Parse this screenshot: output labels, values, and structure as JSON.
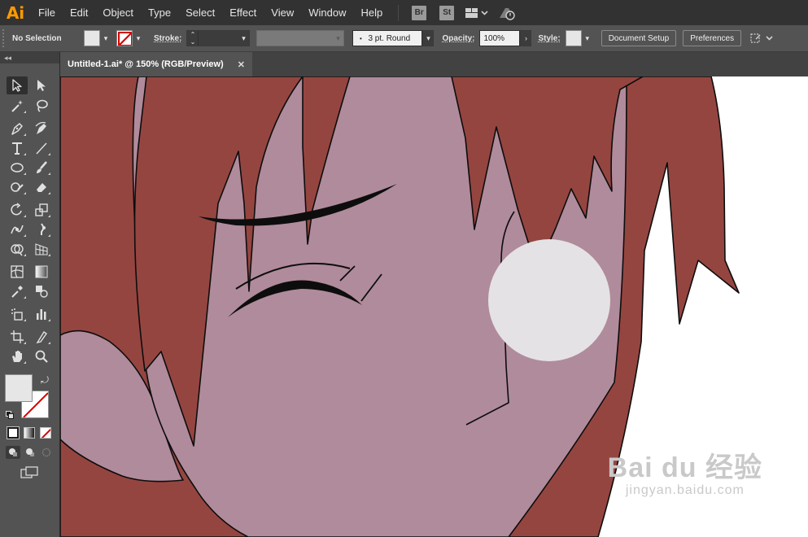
{
  "app": {
    "logo": "Ai",
    "brand_color": "#ff9a00"
  },
  "menubar": {
    "items": [
      "File",
      "Edit",
      "Object",
      "Type",
      "Select",
      "Effect",
      "View",
      "Window",
      "Help"
    ],
    "bridge_label": "Br",
    "stock_label": "St",
    "icons": [
      "workspace-layout-icon",
      "gpu-performance-icon"
    ]
  },
  "controlbar": {
    "selection_status": "No Selection",
    "fill_color": "#e6e6e6",
    "stroke_color": "none",
    "stroke_label": "Stroke:",
    "stroke_weight_value": "",
    "brush_profile": "3 pt. Round",
    "opacity_label": "Opacity:",
    "opacity_value": "100%",
    "style_label": "Style:",
    "document_setup_label": "Document Setup",
    "preferences_label": "Preferences"
  },
  "toolpanel": {
    "collapse_label": "◂◂",
    "tools": [
      "selection-tool",
      "direct-selection-tool",
      "magic-wand-tool",
      "lasso-tool",
      "pen-tool",
      "curvature-tool",
      "type-tool",
      "line-segment-tool",
      "ellipse-tool",
      "paintbrush-tool",
      "shaper-tool",
      "eraser-tool",
      "rotate-tool",
      "scale-tool",
      "width-tool",
      "puppet-warp-tool",
      "shape-builder-tool",
      "perspective-grid-tool",
      "mesh-tool",
      "gradient-tool",
      "eyedropper-tool",
      "blend-tool",
      "symbol-sprayer-tool",
      "column-graph-tool",
      "artboard-tool",
      "slice-tool",
      "hand-tool",
      "zoom-tool"
    ],
    "active_tool": "selection-tool",
    "fill_swatch": "#e6e6e6",
    "stroke_swatch": "none"
  },
  "document": {
    "tab_title": "Untitled-1.ai* @ 150% (RGB/Preview)",
    "close_label": "✕"
  },
  "artwork": {
    "hair_color": "#954540",
    "skin_color": "#b08b9b",
    "blush_color": "#e4e2e4",
    "line_color": "#0d0d0d"
  },
  "watermark": {
    "main": "Bai du 经验",
    "url": "jingyan.baidu.com"
  }
}
